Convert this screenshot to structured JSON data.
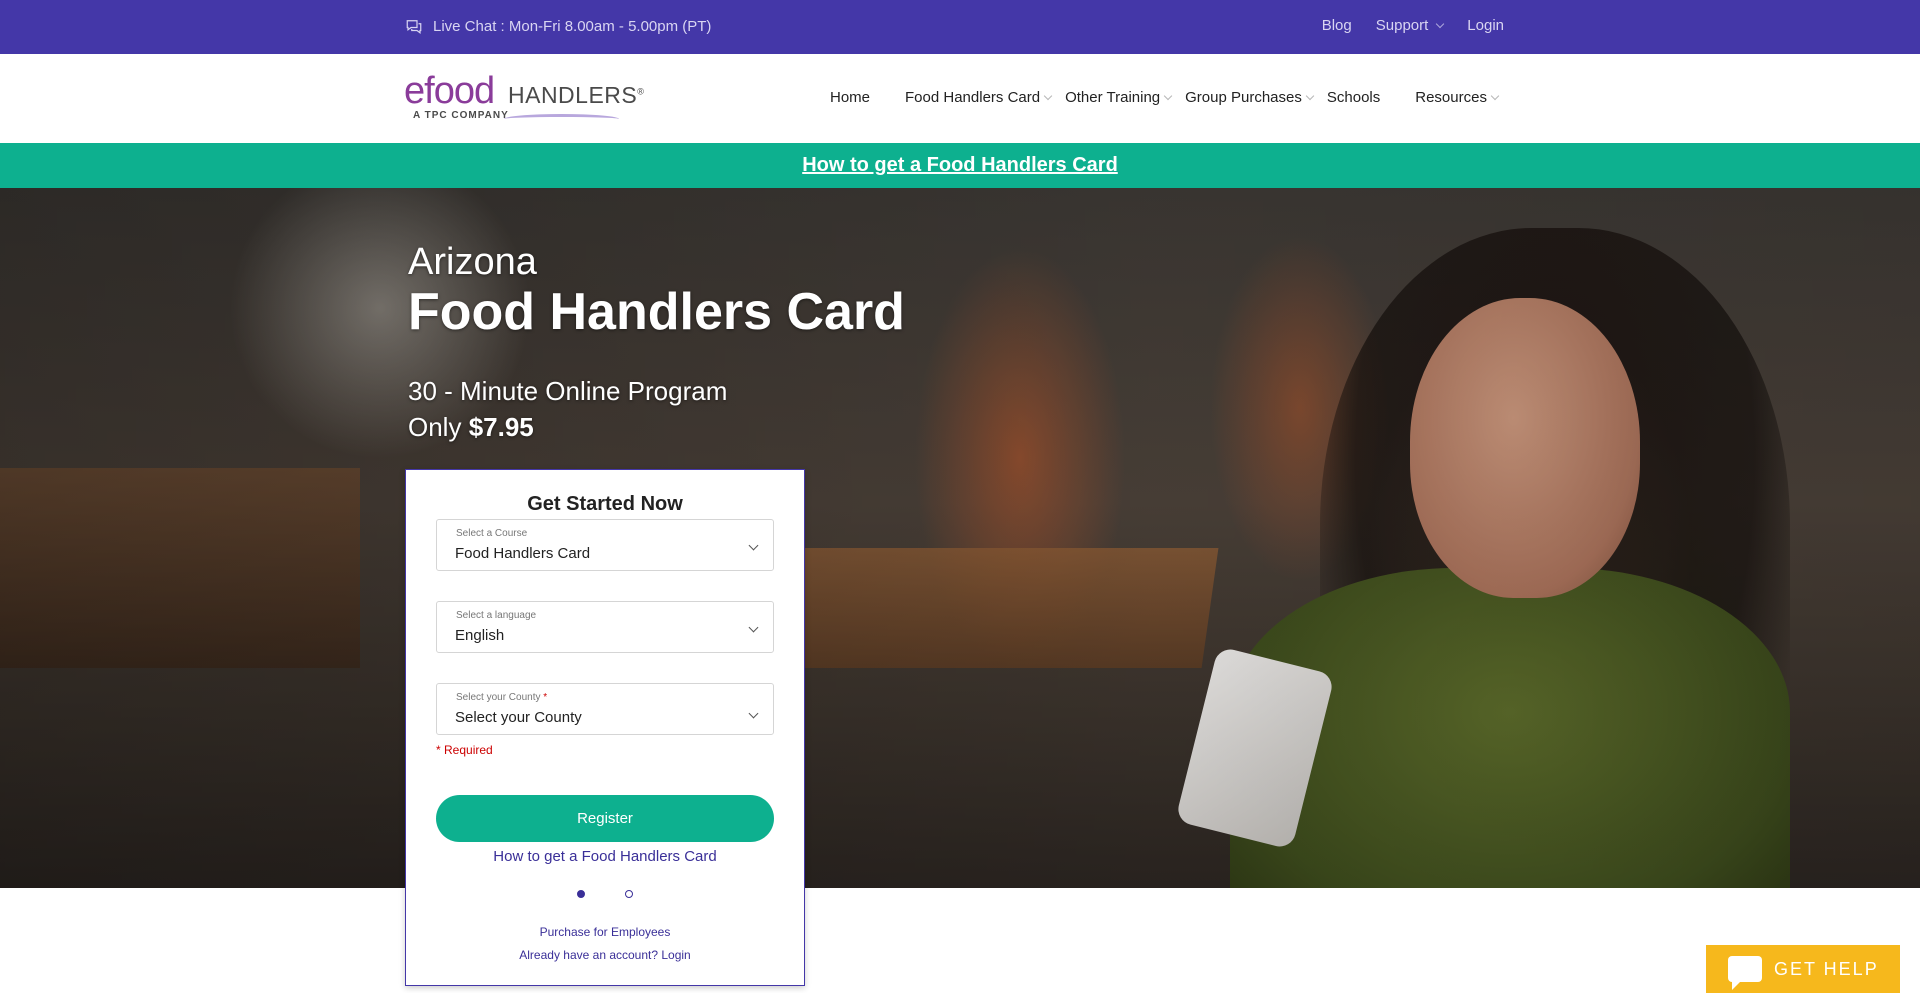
{
  "topbar": {
    "live_chat": "Live Chat : Mon-Fri 8.00am - 5.00pm (PT)",
    "blog": "Blog",
    "support": "Support",
    "login": "Login"
  },
  "logo": {
    "brand_main": "efood",
    "brand_second": "HANDLERS",
    "registered": "®",
    "tagline": "A TPC COMPANY"
  },
  "nav": {
    "items": [
      {
        "label": "Home",
        "dropdown": false
      },
      {
        "label": "Food Handlers Card",
        "dropdown": true
      },
      {
        "label": "Other Training",
        "dropdown": true
      },
      {
        "label": "Group Purchases",
        "dropdown": true
      },
      {
        "label": "Schools",
        "dropdown": false
      },
      {
        "label": "Resources",
        "dropdown": true
      }
    ]
  },
  "banner": {
    "link": "How to get a Food Handlers Card"
  },
  "hero": {
    "state": "Arizona",
    "title": "Food Handlers Card",
    "subtitle": "30 - Minute Online Program",
    "price_prefix": "Only ",
    "price": "$7.95"
  },
  "form": {
    "heading": "Get Started Now",
    "course": {
      "label": "Select a Course",
      "value": "Food Handlers Card"
    },
    "language": {
      "label": "Select a language",
      "value": "English"
    },
    "county": {
      "label": "Select your County",
      "required_mark": "*",
      "value": "Select your County"
    },
    "required_note": "* Required",
    "register": "Register",
    "howto": "How to get a Food Handlers Card",
    "slides": {
      "count": 2,
      "active": 1
    },
    "purchase_employees": "Purchase for Employees",
    "login": "Already have an account? Login"
  },
  "get_help": "GET HELP",
  "colors": {
    "topbar": "#4437a8",
    "accent_green": "#0db08f",
    "link_purple": "#3a2f98",
    "get_help": "#f6b81c"
  }
}
